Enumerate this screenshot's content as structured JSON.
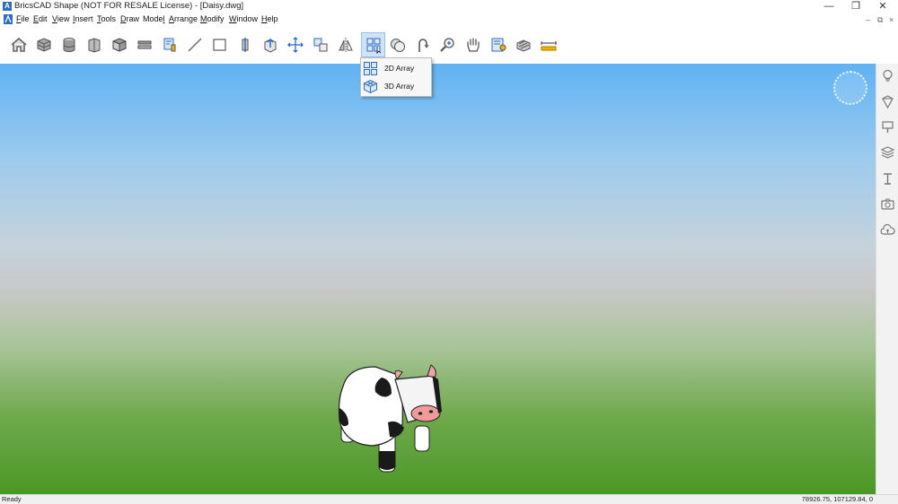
{
  "window": {
    "title": "BricsCAD Shape (NOT FOR RESALE License) - [Daisy.dwg]",
    "minimize": "—",
    "restore": "❐",
    "close": "✕",
    "mdi_minimize": "–",
    "mdi_restore": "⧉",
    "mdi_close": "×"
  },
  "menu": [
    {
      "pre": "",
      "u": "F",
      "post": "ile"
    },
    {
      "pre": "",
      "u": "E",
      "post": "dit"
    },
    {
      "pre": "",
      "u": "V",
      "post": "iew"
    },
    {
      "pre": "",
      "u": "I",
      "post": "nsert"
    },
    {
      "pre": "",
      "u": "T",
      "post": "ools"
    },
    {
      "pre": "",
      "u": "D",
      "post": "raw"
    },
    {
      "pre": "Mode",
      "u": "l",
      "post": ""
    },
    {
      "pre": "",
      "u": "A",
      "post": "rrange"
    },
    {
      "pre": "",
      "u": "M",
      "post": "odify"
    },
    {
      "pre": "",
      "u": "W",
      "post": "indow"
    },
    {
      "pre": "",
      "u": "H",
      "post": "elp"
    }
  ],
  "toolbar": {
    "tools": [
      "home-icon",
      "box-stack-icon",
      "cylinder-stack-icon",
      "wall-icon",
      "solid-box-icon",
      "slab-icon",
      "paint-icon",
      "line-icon",
      "rectangle-icon",
      "extrude-icon",
      "push-pull-icon",
      "move-icon",
      "copy-icon",
      "mirror-icon",
      "array-icon",
      "union-icon",
      "rotate-icon",
      "zoom-icon",
      "pan-icon",
      "render-icon",
      "section-icon",
      "measure-icon"
    ],
    "active_tool": "array-icon"
  },
  "array_menu": {
    "items": [
      {
        "label": "2D Array",
        "icon": "array-2d-icon"
      },
      {
        "label": "3D Array",
        "icon": "array-3d-icon"
      }
    ]
  },
  "right_panel": [
    "lightbulb-icon",
    "material-icon",
    "stamp-icon",
    "layers-icon",
    "text-icon",
    "camera-icon",
    "cloud-icon"
  ],
  "status": {
    "text": "Ready",
    "coords": "78926.75, 107129.84, 0"
  },
  "colors": {
    "sky_top": "#5fb2f3",
    "ground": "#4b9825",
    "highlight": "#cfe3f7",
    "accent": "#2b6cc4"
  }
}
